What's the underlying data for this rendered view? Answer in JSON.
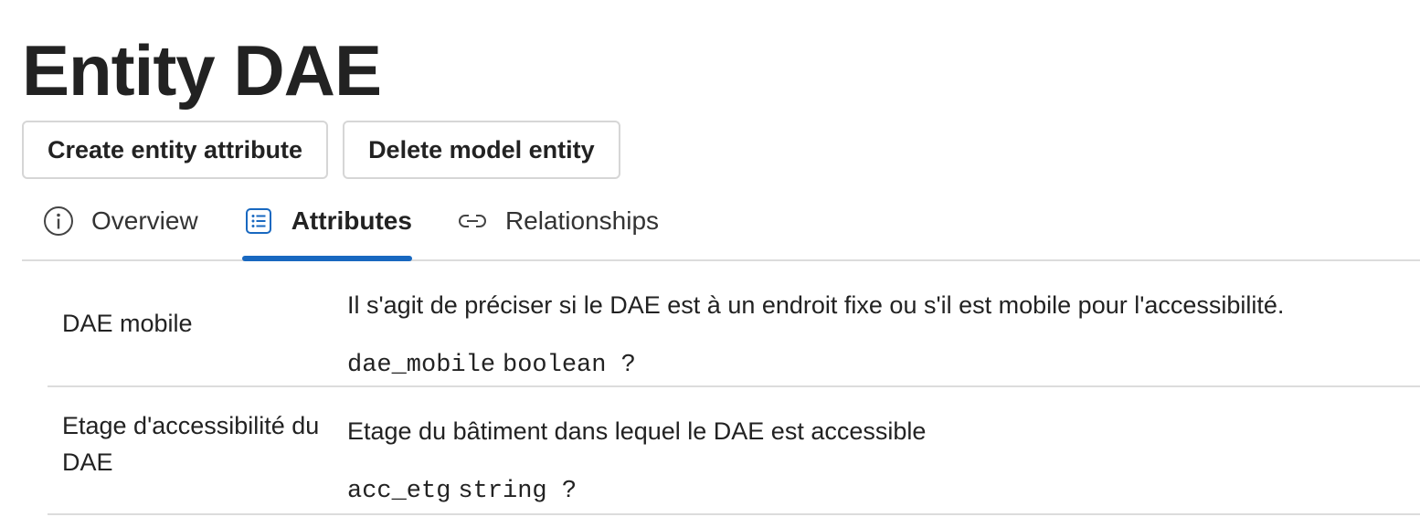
{
  "page": {
    "title": "Entity DAE"
  },
  "actions": {
    "create_label": "Create entity attribute",
    "delete_label": "Delete model entity"
  },
  "tabs": [
    {
      "label": "Overview",
      "icon": "info-icon",
      "active": false
    },
    {
      "label": "Attributes",
      "icon": "list-icon",
      "active": true
    },
    {
      "label": "Relationships",
      "icon": "link-icon",
      "active": false
    }
  ],
  "colors": {
    "accent": "#1868c0",
    "divider": "#dcdcdc",
    "button_border": "#d6d6d6"
  },
  "attributes": [
    {
      "name": "DAE mobile",
      "description": "Il s'agit de préciser si le DAE est à un endroit fixe ou s'il est mobile pour l'accessibilité.",
      "key": "dae_mobile",
      "type": "boolean ?"
    },
    {
      "name": "Etage d'accessibilité du DAE",
      "description": "Etage du bâtiment dans lequel le DAE est accessible",
      "key": "acc_etg",
      "type": "string ?"
    }
  ]
}
